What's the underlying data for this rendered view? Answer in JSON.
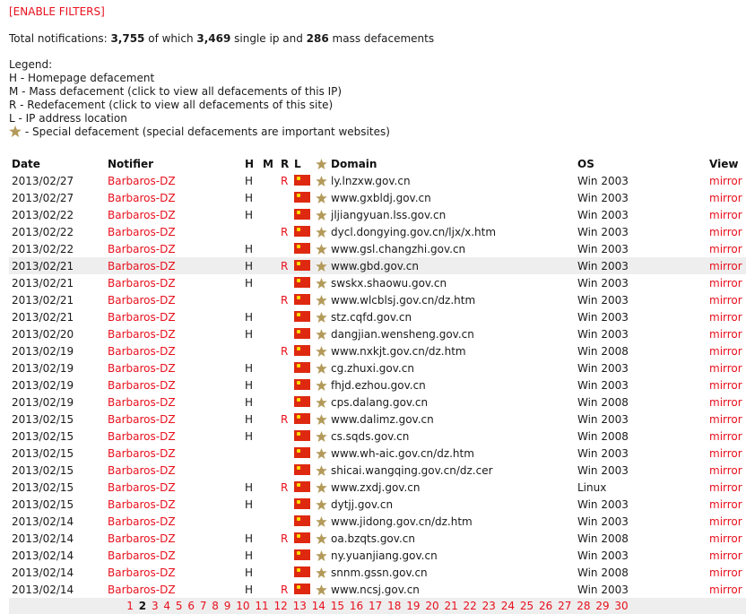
{
  "filters_link": "[ENABLE FILTERS]",
  "summary": {
    "prefix": "Total notifications: ",
    "total": "3,755",
    "mid1": " of which ",
    "single": "3,469",
    "mid2": " single ip and ",
    "mass": "286",
    "suffix": " mass defacements"
  },
  "legend": {
    "title": "Legend:",
    "items": [
      "H - Homepage defacement",
      "M - Mass defacement (click to view all defacements of this IP)",
      "R - Redefacement (click to view all defacements of this site)",
      "L - IP address location",
      " - Special defacement (special defacements are important websites)"
    ]
  },
  "colors": {
    "link": "#e8101d",
    "star": "#b39a5a",
    "highlight_row": "#eeeeee",
    "flag": "#de2910"
  },
  "table": {
    "headers": {
      "date": "Date",
      "notifier": "Notifier",
      "h": "H",
      "m": "M",
      "r": "R",
      "l": "L",
      "star": "star-icon",
      "domain": "Domain",
      "os": "OS",
      "view": "View"
    },
    "rows": [
      {
        "date": "2013/02/27",
        "notifier": "Barbaros-DZ",
        "h": "H",
        "m": "",
        "r": "R",
        "domain": "ly.lnzxw.gov.cn",
        "os": "Win 2003",
        "view": "mirror"
      },
      {
        "date": "2013/02/27",
        "notifier": "Barbaros-DZ",
        "h": "H",
        "m": "",
        "r": "",
        "domain": "www.gxbldj.gov.cn",
        "os": "Win 2003",
        "view": "mirror"
      },
      {
        "date": "2013/02/22",
        "notifier": "Barbaros-DZ",
        "h": "H",
        "m": "",
        "r": "",
        "domain": "jljiangyuan.lss.gov.cn",
        "os": "Win 2003",
        "view": "mirror"
      },
      {
        "date": "2013/02/22",
        "notifier": "Barbaros-DZ",
        "h": "",
        "m": "",
        "r": "R",
        "domain": "dycl.dongying.gov.cn/ljx/x.htm",
        "os": "Win 2003",
        "view": "mirror"
      },
      {
        "date": "2013/02/22",
        "notifier": "Barbaros-DZ",
        "h": "H",
        "m": "",
        "r": "",
        "domain": "www.gsl.changzhi.gov.cn",
        "os": "Win 2003",
        "view": "mirror"
      },
      {
        "date": "2013/02/21",
        "notifier": "Barbaros-DZ",
        "h": "H",
        "m": "",
        "r": "R",
        "domain": "www.gbd.gov.cn",
        "os": "Win 2003",
        "view": "mirror",
        "highlighted": true
      },
      {
        "date": "2013/02/21",
        "notifier": "Barbaros-DZ",
        "h": "H",
        "m": "",
        "r": "",
        "domain": "swskx.shaowu.gov.cn",
        "os": "Win 2003",
        "view": "mirror"
      },
      {
        "date": "2013/02/21",
        "notifier": "Barbaros-DZ",
        "h": "",
        "m": "",
        "r": "R",
        "domain": "www.wlcblsj.gov.cn/dz.htm",
        "os": "Win 2003",
        "view": "mirror"
      },
      {
        "date": "2013/02/21",
        "notifier": "Barbaros-DZ",
        "h": "H",
        "m": "",
        "r": "",
        "domain": "stz.cqfd.gov.cn",
        "os": "Win 2003",
        "view": "mirror"
      },
      {
        "date": "2013/02/20",
        "notifier": "Barbaros-DZ",
        "h": "H",
        "m": "",
        "r": "",
        "domain": "dangjian.wensheng.gov.cn",
        "os": "Win 2003",
        "view": "mirror"
      },
      {
        "date": "2013/02/19",
        "notifier": "Barbaros-DZ",
        "h": "",
        "m": "",
        "r": "R",
        "domain": "www.nxkjt.gov.cn/dz.htm",
        "os": "Win 2008",
        "view": "mirror"
      },
      {
        "date": "2013/02/19",
        "notifier": "Barbaros-DZ",
        "h": "H",
        "m": "",
        "r": "",
        "domain": "cg.zhuxi.gov.cn",
        "os": "Win 2003",
        "view": "mirror"
      },
      {
        "date": "2013/02/19",
        "notifier": "Barbaros-DZ",
        "h": "H",
        "m": "",
        "r": "",
        "domain": "fhjd.ezhou.gov.cn",
        "os": "Win 2003",
        "view": "mirror"
      },
      {
        "date": "2013/02/19",
        "notifier": "Barbaros-DZ",
        "h": "H",
        "m": "",
        "r": "",
        "domain": "cps.dalang.gov.cn",
        "os": "Win 2008",
        "view": "mirror"
      },
      {
        "date": "2013/02/15",
        "notifier": "Barbaros-DZ",
        "h": "H",
        "m": "",
        "r": "R",
        "domain": "www.dalimz.gov.cn",
        "os": "Win 2003",
        "view": "mirror"
      },
      {
        "date": "2013/02/15",
        "notifier": "Barbaros-DZ",
        "h": "H",
        "m": "",
        "r": "",
        "domain": "cs.sqds.gov.cn",
        "os": "Win 2008",
        "view": "mirror"
      },
      {
        "date": "2013/02/15",
        "notifier": "Barbaros-DZ",
        "h": "",
        "m": "",
        "r": "",
        "domain": "www.wh-aic.gov.cn/dz.htm",
        "os": "Win 2003",
        "view": "mirror"
      },
      {
        "date": "2013/02/15",
        "notifier": "Barbaros-DZ",
        "h": "",
        "m": "",
        "r": "",
        "domain": "shicai.wangqing.gov.cn/dz.cer",
        "os": "Win 2003",
        "view": "mirror"
      },
      {
        "date": "2013/02/15",
        "notifier": "Barbaros-DZ",
        "h": "H",
        "m": "",
        "r": "R",
        "domain": "www.zxdj.gov.cn",
        "os": "Linux",
        "view": "mirror"
      },
      {
        "date": "2013/02/15",
        "notifier": "Barbaros-DZ",
        "h": "H",
        "m": "",
        "r": "",
        "domain": "dytjj.gov.cn",
        "os": "Win 2003",
        "view": "mirror"
      },
      {
        "date": "2013/02/14",
        "notifier": "Barbaros-DZ",
        "h": "",
        "m": "",
        "r": "",
        "domain": "www.jidong.gov.cn/dz.htm",
        "os": "Win 2003",
        "view": "mirror"
      },
      {
        "date": "2013/02/14",
        "notifier": "Barbaros-DZ",
        "h": "H",
        "m": "",
        "r": "R",
        "domain": "oa.bzqts.gov.cn",
        "os": "Win 2008",
        "view": "mirror"
      },
      {
        "date": "2013/02/14",
        "notifier": "Barbaros-DZ",
        "h": "H",
        "m": "",
        "r": "",
        "domain": "ny.yuanjiang.gov.cn",
        "os": "Win 2003",
        "view": "mirror"
      },
      {
        "date": "2013/02/14",
        "notifier": "Barbaros-DZ",
        "h": "H",
        "m": "",
        "r": "",
        "domain": "snnm.gssn.gov.cn",
        "os": "Win 2008",
        "view": "mirror"
      },
      {
        "date": "2013/02/14",
        "notifier": "Barbaros-DZ",
        "h": "H",
        "m": "",
        "r": "R",
        "domain": "www.ncsj.gov.cn",
        "os": "Win 2003",
        "view": "mirror"
      }
    ]
  },
  "pagination": {
    "current": "2",
    "pages": [
      "1",
      "2",
      "3",
      "4",
      "5",
      "6",
      "7",
      "8",
      "9",
      "10",
      "11",
      "12",
      "13",
      "14",
      "15",
      "16",
      "17",
      "18",
      "19",
      "20",
      "21",
      "22",
      "23",
      "24",
      "25",
      "26",
      "27",
      "28",
      "29",
      "30"
    ]
  }
}
